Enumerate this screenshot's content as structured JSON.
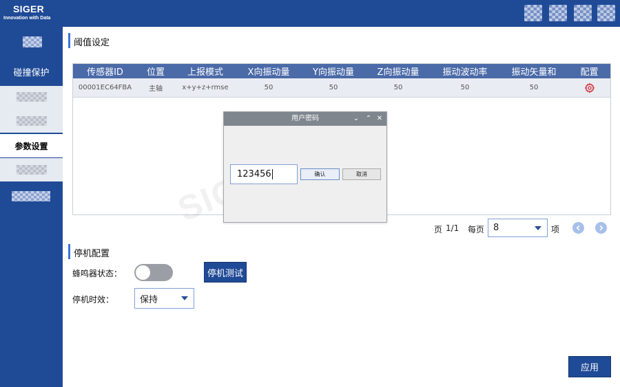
{
  "brand": {
    "name": "SIGER",
    "tagline": "Innovation with Data"
  },
  "header": {
    "icons": [
      "blurred-icon",
      "blurred-icon",
      "blurred-icon",
      "blurred-icon"
    ]
  },
  "sidebar": {
    "items": [
      {
        "label": "碰撞保护",
        "state": "dark"
      },
      {
        "label": "参数设置",
        "state": "active"
      }
    ]
  },
  "threshold": {
    "title": "阈值设定",
    "columns": [
      "传感器ID",
      "位置",
      "上报模式",
      "X向振动量",
      "Y向振动量",
      "Z向振动量",
      "振动波动率",
      "振动矢量和",
      "配置"
    ],
    "rows": [
      {
        "sensor_id": "00001EC64FBA",
        "position": "主轴",
        "mode": "x+y+z+rmse",
        "x": "50",
        "y": "50",
        "z": "50",
        "fluct": "50",
        "vector": "50",
        "config_icon": "gear-icon"
      }
    ]
  },
  "pager": {
    "page_label": "页",
    "page_value": "1/1",
    "per_page_label": "每页",
    "per_page_value": "8",
    "unit": "项"
  },
  "dialog": {
    "title": "用户密码",
    "password_value": "123456",
    "confirm_label": "确认",
    "cancel_label": "取消"
  },
  "watermark": "SIGER DATA",
  "shutdown": {
    "title": "停机配置",
    "buzzer_label": "蜂鸣器状态：",
    "buzzer_on": false,
    "test_button": "停机测试",
    "timeout_label": "停机时效：",
    "timeout_value": "保持"
  },
  "apply_label": "应用",
  "colors": {
    "primary": "#1f4a96",
    "table_header": "#4a6aa8",
    "accent_bar": "#3a74d6",
    "gear": "#d0202a"
  }
}
